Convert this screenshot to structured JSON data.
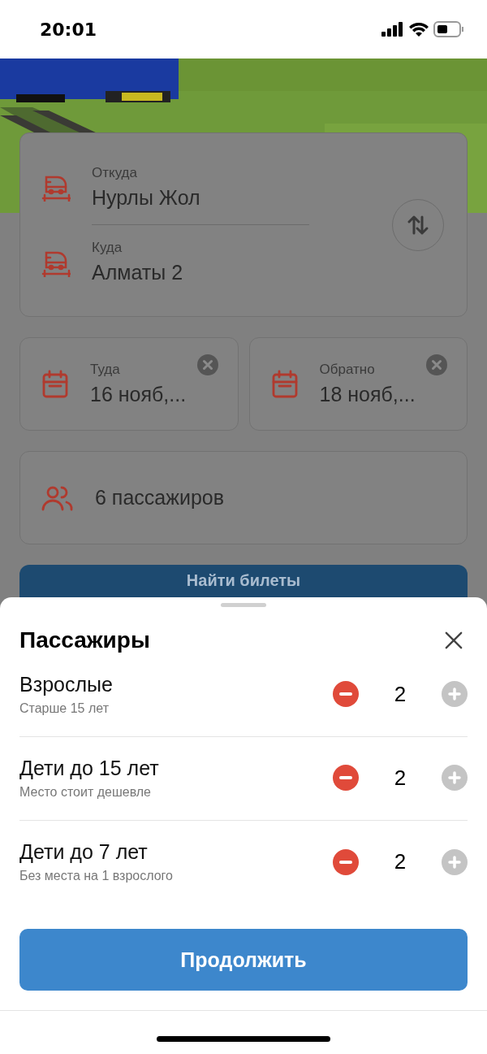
{
  "status_bar": {
    "time": "20:01"
  },
  "route": {
    "from": {
      "label": "Откуда",
      "value": "Нурлы Жол"
    },
    "to": {
      "label": "Куда",
      "value": "Алматы 2"
    }
  },
  "dates": [
    {
      "label": "Туда",
      "value": "16 нояб,..."
    },
    {
      "label": "Обратно",
      "value": "18 нояб,..."
    }
  ],
  "passengers_field": {
    "value": "6 пассажиров"
  },
  "search_button": {
    "label": "Найти билеты"
  },
  "sheet": {
    "title": "Пассажиры",
    "rows": [
      {
        "name": "Взрослые",
        "hint": "Старше 15 лет",
        "count": "2",
        "minus_disabled": false,
        "plus_disabled": true
      },
      {
        "name": "Дети до 15 лет",
        "hint": "Место стоит дешевле",
        "count": "2",
        "minus_disabled": false,
        "plus_disabled": true
      },
      {
        "name": "Дети до 7 лет",
        "hint": "Без места на 1 взрослого",
        "count": "2",
        "minus_disabled": false,
        "plus_disabled": true
      }
    ],
    "continue_button": {
      "label": "Продолжить"
    }
  }
}
